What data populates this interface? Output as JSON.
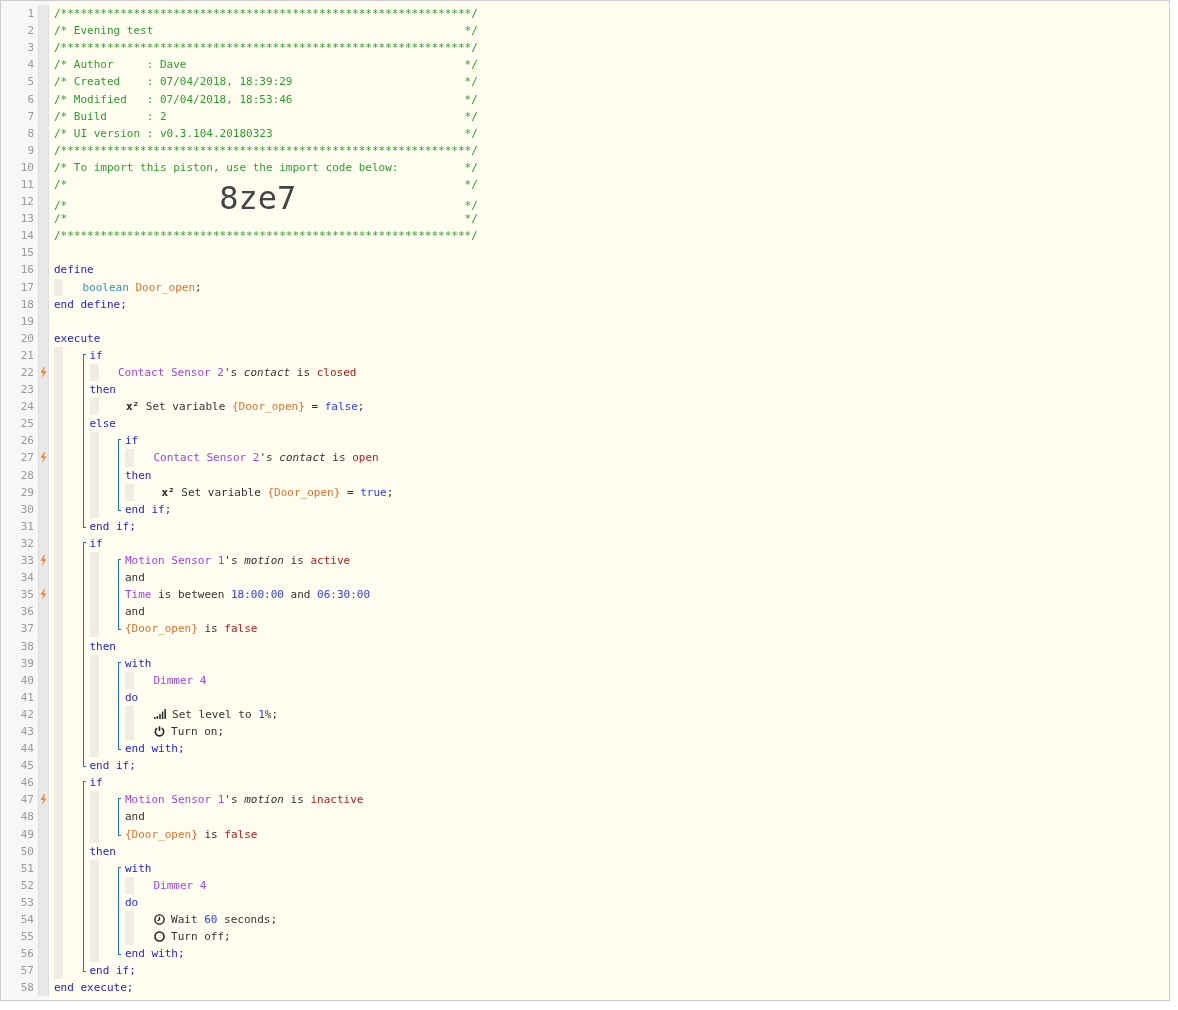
{
  "code": [
    {
      "kind": "line",
      "number": "1",
      "trigger": false,
      "tokens": [
        {
          "kind": "comment",
          "text": "/**************************************************************/"
        }
      ]
    },
    {
      "kind": "line",
      "number": "2",
      "trigger": false,
      "tokens": [
        {
          "kind": "comment",
          "text": "/* Evening test"
        },
        {
          "kind": "comment_end",
          "text": "*/"
        }
      ]
    },
    {
      "kind": "line",
      "number": "3",
      "trigger": false,
      "tokens": [
        {
          "kind": "comment",
          "text": "/**************************************************************/"
        }
      ]
    },
    {
      "kind": "line",
      "number": "4",
      "trigger": false,
      "tokens": [
        {
          "kind": "comment",
          "text": "/* Author     : Dave"
        },
        {
          "kind": "comment_end",
          "text": "*/"
        }
      ]
    },
    {
      "kind": "line",
      "number": "5",
      "trigger": false,
      "tokens": [
        {
          "kind": "comment",
          "text": "/* Created    : 07/04/2018, 18:39:29"
        },
        {
          "kind": "comment_end",
          "text": "*/"
        }
      ]
    },
    {
      "kind": "line",
      "number": "6",
      "trigger": false,
      "tokens": [
        {
          "kind": "comment",
          "text": "/* Modified   : 07/04/2018, 18:53:46"
        },
        {
          "kind": "comment_end",
          "text": "*/"
        }
      ]
    },
    {
      "kind": "line",
      "number": "7",
      "trigger": false,
      "tokens": [
        {
          "kind": "comment",
          "text": "/* Build      : 2"
        },
        {
          "kind": "comment_end",
          "text": "*/"
        }
      ]
    },
    {
      "kind": "line",
      "number": "8",
      "trigger": false,
      "tokens": [
        {
          "kind": "comment",
          "text": "/* UI version : v0.3.104.20180323"
        },
        {
          "kind": "comment_end",
          "text": "*/"
        }
      ]
    },
    {
      "kind": "line",
      "number": "9",
      "trigger": false,
      "tokens": [
        {
          "kind": "comment",
          "text": "/**************************************************************/"
        }
      ]
    },
    {
      "kind": "line",
      "number": "10",
      "trigger": false,
      "tokens": [
        {
          "kind": "comment",
          "text": "/* To import this piston, use the import code below:"
        },
        {
          "kind": "comment_end",
          "text": "*/"
        }
      ]
    },
    {
      "kind": "line",
      "number": "11",
      "trigger": false,
      "tokens": [
        {
          "kind": "comment",
          "text": "/*"
        },
        {
          "kind": "comment_end",
          "text": "*/"
        }
      ]
    },
    {
      "kind": "line",
      "number": "12",
      "trigger": false,
      "tokens": [
        {
          "kind": "comment",
          "text": "/*"
        },
        {
          "kind": "import_code",
          "text": "8ze7"
        },
        {
          "kind": "comment_end",
          "text": "*/"
        }
      ]
    },
    {
      "kind": "line",
      "number": "13",
      "trigger": false,
      "tokens": [
        {
          "kind": "comment",
          "text": "/*"
        },
        {
          "kind": "comment_end",
          "text": "*/"
        }
      ]
    },
    {
      "kind": "line",
      "number": "14",
      "trigger": false,
      "tokens": [
        {
          "kind": "comment",
          "text": "/**************************************************************/"
        }
      ]
    },
    {
      "kind": "line",
      "number": "15",
      "trigger": false
    },
    {
      "kind": "line",
      "number": "16",
      "trigger": false,
      "tokens": [
        {
          "kind": "keyword",
          "text": "define"
        }
      ]
    },
    {
      "kind": "body",
      "children": [
        {
          "kind": "line",
          "number": "17",
          "trigger": false,
          "tokens": [
            {
              "kind": "type",
              "text": "boolean "
            },
            {
              "kind": "variable",
              "text": "Door_open"
            },
            {
              "kind": "text",
              "text": ";"
            }
          ]
        }
      ]
    },
    {
      "kind": "line",
      "number": "18",
      "trigger": false,
      "tokens": [
        {
          "kind": "keyword",
          "text": "end define;"
        }
      ]
    },
    {
      "kind": "line",
      "number": "19",
      "trigger": false
    },
    {
      "kind": "line",
      "number": "20",
      "trigger": false,
      "tokens": [
        {
          "kind": "keyword",
          "text": "execute"
        }
      ]
    },
    {
      "kind": "body",
      "children": [
        {
          "kind": "block",
          "bracket": true,
          "children": [
            {
              "kind": "line",
              "number": "21",
              "trigger": false,
              "tokens": [
                {
                  "kind": "keyword",
                  "text": "if"
                }
              ]
            },
            {
              "kind": "body",
              "children": [
                {
                  "kind": "line",
                  "number": "22",
                  "trigger": true,
                  "tokens": [
                    {
                      "kind": "device",
                      "text": "Contact Sensor 2"
                    },
                    {
                      "kind": "text",
                      "text": "'s "
                    },
                    {
                      "kind": "attribute",
                      "text": "contact"
                    },
                    {
                      "kind": "text",
                      "text": " is "
                    },
                    {
                      "kind": "value",
                      "text": "closed"
                    }
                  ]
                }
              ]
            },
            {
              "kind": "line",
              "number": "23",
              "trigger": false,
              "tokens": [
                {
                  "kind": "keyword",
                  "text": "then"
                }
              ]
            },
            {
              "kind": "body",
              "children": [
                {
                  "kind": "block",
                  "bracket": false,
                  "children": [
                    {
                      "kind": "line",
                      "number": "24",
                      "trigger": false,
                      "tokens": [
                        {
                          "kind": "symbol",
                          "text": "x²"
                        },
                        {
                          "kind": "text",
                          "text": " Set variable "
                        },
                        {
                          "kind": "variable",
                          "text": "{Door_open}"
                        },
                        {
                          "kind": "text",
                          "text": " = "
                        },
                        {
                          "kind": "literal",
                          "text": "false"
                        },
                        {
                          "kind": "text",
                          "text": ";"
                        }
                      ]
                    }
                  ]
                }
              ]
            },
            {
              "kind": "line",
              "number": "25",
              "trigger": false,
              "tokens": [
                {
                  "kind": "keyword",
                  "text": "else"
                }
              ]
            },
            {
              "kind": "body",
              "children": [
                {
                  "kind": "block",
                  "bracket": true,
                  "children": [
                    {
                      "kind": "line",
                      "number": "26",
                      "trigger": false,
                      "tokens": [
                        {
                          "kind": "keyword",
                          "text": "if"
                        }
                      ]
                    },
                    {
                      "kind": "body",
                      "children": [
                        {
                          "kind": "line",
                          "number": "27",
                          "trigger": true,
                          "tokens": [
                            {
                              "kind": "device",
                              "text": "Contact Sensor 2"
                            },
                            {
                              "kind": "text",
                              "text": "'s "
                            },
                            {
                              "kind": "attribute",
                              "text": "contact"
                            },
                            {
                              "kind": "text",
                              "text": " is "
                            },
                            {
                              "kind": "value",
                              "text": "open"
                            }
                          ]
                        }
                      ]
                    },
                    {
                      "kind": "line",
                      "number": "28",
                      "trigger": false,
                      "tokens": [
                        {
                          "kind": "keyword",
                          "text": "then"
                        }
                      ]
                    },
                    {
                      "kind": "body",
                      "children": [
                        {
                          "kind": "block",
                          "bracket": false,
                          "children": [
                            {
                              "kind": "line",
                              "number": "29",
                              "trigger": false,
                              "tokens": [
                                {
                                  "kind": "symbol",
                                  "text": "x²"
                                },
                                {
                                  "kind": "text",
                                  "text": " Set variable "
                                },
                                {
                                  "kind": "variable",
                                  "text": "{Door_open}"
                                },
                                {
                                  "kind": "text",
                                  "text": " = "
                                },
                                {
                                  "kind": "literal",
                                  "text": "true"
                                },
                                {
                                  "kind": "text",
                                  "text": ";"
                                }
                              ]
                            }
                          ]
                        }
                      ]
                    },
                    {
                      "kind": "line",
                      "number": "30",
                      "trigger": false,
                      "tokens": [
                        {
                          "kind": "keyword",
                          "text": "end if;"
                        }
                      ]
                    }
                  ]
                }
              ]
            },
            {
              "kind": "line",
              "number": "31",
              "trigger": false,
              "tokens": [
                {
                  "kind": "keyword",
                  "text": "end if;"
                }
              ]
            }
          ]
        },
        {
          "kind": "block",
          "bracket": true,
          "children": [
            {
              "kind": "line",
              "number": "32",
              "trigger": false,
              "tokens": [
                {
                  "kind": "keyword",
                  "text": "if"
                }
              ]
            },
            {
              "kind": "body",
              "children": [
                {
                  "kind": "block",
                  "bracket": true,
                  "children": [
                    {
                      "kind": "line",
                      "number": "33",
                      "trigger": true,
                      "tokens": [
                        {
                          "kind": "device",
                          "text": "Motion Sensor 1"
                        },
                        {
                          "kind": "text",
                          "text": "'s "
                        },
                        {
                          "kind": "attribute",
                          "text": "motion"
                        },
                        {
                          "kind": "text",
                          "text": " is "
                        },
                        {
                          "kind": "value",
                          "text": "active"
                        }
                      ]
                    },
                    {
                      "kind": "line",
                      "number": "34",
                      "trigger": false,
                      "tokens": [
                        {
                          "kind": "text",
                          "text": "and"
                        }
                      ]
                    },
                    {
                      "kind": "line",
                      "number": "35",
                      "trigger": true,
                      "tokens": [
                        {
                          "kind": "device",
                          "text": "Time"
                        },
                        {
                          "kind": "text",
                          "text": " is between "
                        },
                        {
                          "kind": "number",
                          "text": "18:00:00"
                        },
                        {
                          "kind": "text",
                          "text": " and "
                        },
                        {
                          "kind": "number",
                          "text": "06:30:00"
                        }
                      ]
                    },
                    {
                      "kind": "line",
                      "number": "36",
                      "trigger": false,
                      "tokens": [
                        {
                          "kind": "text",
                          "text": "and"
                        }
                      ]
                    },
                    {
                      "kind": "line",
                      "number": "37",
                      "trigger": false,
                      "tokens": [
                        {
                          "kind": "variable",
                          "text": "{Door_open}"
                        },
                        {
                          "kind": "text",
                          "text": " is "
                        },
                        {
                          "kind": "value",
                          "text": "false"
                        }
                      ]
                    }
                  ]
                }
              ]
            },
            {
              "kind": "line",
              "number": "38",
              "trigger": false,
              "tokens": [
                {
                  "kind": "keyword",
                  "text": "then"
                }
              ]
            },
            {
              "kind": "body",
              "children": [
                {
                  "kind": "block",
                  "bracket": true,
                  "children": [
                    {
                      "kind": "line",
                      "number": "39",
                      "trigger": false,
                      "tokens": [
                        {
                          "kind": "keyword",
                          "text": "with"
                        }
                      ]
                    },
                    {
                      "kind": "body",
                      "children": [
                        {
                          "kind": "line",
                          "number": "40",
                          "trigger": false,
                          "tokens": [
                            {
                              "kind": "device",
                              "text": "Dimmer 4"
                            }
                          ]
                        }
                      ]
                    },
                    {
                      "kind": "line",
                      "number": "41",
                      "trigger": false,
                      "tokens": [
                        {
                          "kind": "keyword",
                          "text": "do"
                        }
                      ]
                    },
                    {
                      "kind": "body",
                      "children": [
                        {
                          "kind": "line",
                          "number": "42",
                          "trigger": false,
                          "tokens": [
                            {
                              "kind": "signal_icon"
                            },
                            {
                              "kind": "text",
                              "text": " Set level to "
                            },
                            {
                              "kind": "number",
                              "text": "1"
                            },
                            {
                              "kind": "text",
                              "text": "%;"
                            }
                          ]
                        },
                        {
                          "kind": "line",
                          "number": "43",
                          "trigger": false,
                          "tokens": [
                            {
                              "kind": "power_icon"
                            },
                            {
                              "kind": "text",
                              "text": " Turn on;"
                            }
                          ]
                        }
                      ]
                    },
                    {
                      "kind": "line",
                      "number": "44",
                      "trigger": false,
                      "tokens": [
                        {
                          "kind": "keyword",
                          "text": "end with;"
                        }
                      ]
                    }
                  ]
                }
              ]
            },
            {
              "kind": "line",
              "number": "45",
              "trigger": false,
              "tokens": [
                {
                  "kind": "keyword",
                  "text": "end if;"
                }
              ]
            }
          ]
        },
        {
          "kind": "block",
          "bracket": true,
          "children": [
            {
              "kind": "line",
              "number": "46",
              "trigger": false,
              "tokens": [
                {
                  "kind": "keyword",
                  "text": "if"
                }
              ]
            },
            {
              "kind": "body",
              "children": [
                {
                  "kind": "block",
                  "bracket": true,
                  "children": [
                    {
                      "kind": "line",
                      "number": "47",
                      "trigger": true,
                      "tokens": [
                        {
                          "kind": "device",
                          "text": "Motion Sensor 1"
                        },
                        {
                          "kind": "text",
                          "text": "'s "
                        },
                        {
                          "kind": "attribute",
                          "text": "motion"
                        },
                        {
                          "kind": "text",
                          "text": " is "
                        },
                        {
                          "kind": "value",
                          "text": "inactive"
                        }
                      ]
                    },
                    {
                      "kind": "line",
                      "number": "48",
                      "trigger": false,
                      "tokens": [
                        {
                          "kind": "text",
                          "text": "and"
                        }
                      ]
                    },
                    {
                      "kind": "line",
                      "number": "49",
                      "trigger": false,
                      "tokens": [
                        {
                          "kind": "variable",
                          "text": "{Door_open}"
                        },
                        {
                          "kind": "text",
                          "text": " is "
                        },
                        {
                          "kind": "value",
                          "text": "false"
                        }
                      ]
                    }
                  ]
                }
              ]
            },
            {
              "kind": "line",
              "number": "50",
              "trigger": false,
              "tokens": [
                {
                  "kind": "keyword",
                  "text": "then"
                }
              ]
            },
            {
              "kind": "body",
              "children": [
                {
                  "kind": "block",
                  "bracket": true,
                  "children": [
                    {
                      "kind": "line",
                      "number": "51",
                      "trigger": false,
                      "tokens": [
                        {
                          "kind": "keyword",
                          "text": "with"
                        }
                      ]
                    },
                    {
                      "kind": "body",
                      "children": [
                        {
                          "kind": "line",
                          "number": "52",
                          "trigger": false,
                          "tokens": [
                            {
                              "kind": "device",
                              "text": "Dimmer 4"
                            }
                          ]
                        }
                      ]
                    },
                    {
                      "kind": "line",
                      "number": "53",
                      "trigger": false,
                      "tokens": [
                        {
                          "kind": "keyword",
                          "text": "do"
                        }
                      ]
                    },
                    {
                      "kind": "body",
                      "children": [
                        {
                          "kind": "line",
                          "number": "54",
                          "trigger": false,
                          "tokens": [
                            {
                              "kind": "clock_icon"
                            },
                            {
                              "kind": "text",
                              "text": " Wait "
                            },
                            {
                              "kind": "number",
                              "text": "60"
                            },
                            {
                              "kind": "text",
                              "text": " seconds;"
                            }
                          ]
                        },
                        {
                          "kind": "line",
                          "number": "55",
                          "trigger": false,
                          "tokens": [
                            {
                              "kind": "ring_icon"
                            },
                            {
                              "kind": "text",
                              "text": " Turn off;"
                            }
                          ]
                        }
                      ]
                    },
                    {
                      "kind": "line",
                      "number": "56",
                      "trigger": false,
                      "tokens": [
                        {
                          "kind": "keyword",
                          "text": "end with;"
                        }
                      ]
                    }
                  ]
                }
              ]
            },
            {
              "kind": "line",
              "number": "57",
              "trigger": false,
              "tokens": [
                {
                  "kind": "keyword",
                  "text": "end if;"
                }
              ]
            }
          ]
        }
      ]
    },
    {
      "kind": "line",
      "number": "58",
      "trigger": false,
      "tokens": [
        {
          "kind": "keyword",
          "text": "end execute;"
        }
      ]
    }
  ]
}
